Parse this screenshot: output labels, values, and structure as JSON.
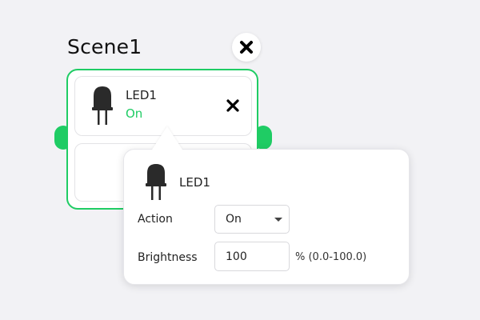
{
  "scene": {
    "title": "Scene1",
    "accent_color": "#1fcc64",
    "close_icon": "close-icon"
  },
  "device_card": {
    "icon": "led-icon",
    "name": "LED1",
    "state": "On",
    "state_color": "#1fcc64",
    "remove_icon": "close-icon"
  },
  "popover": {
    "icon": "led-icon",
    "device_name": "LED1",
    "action_label": "Action",
    "action_value": "On",
    "brightness_label": "Brightness",
    "brightness_value": "100",
    "brightness_hint": "% (0.0-100.0)"
  }
}
